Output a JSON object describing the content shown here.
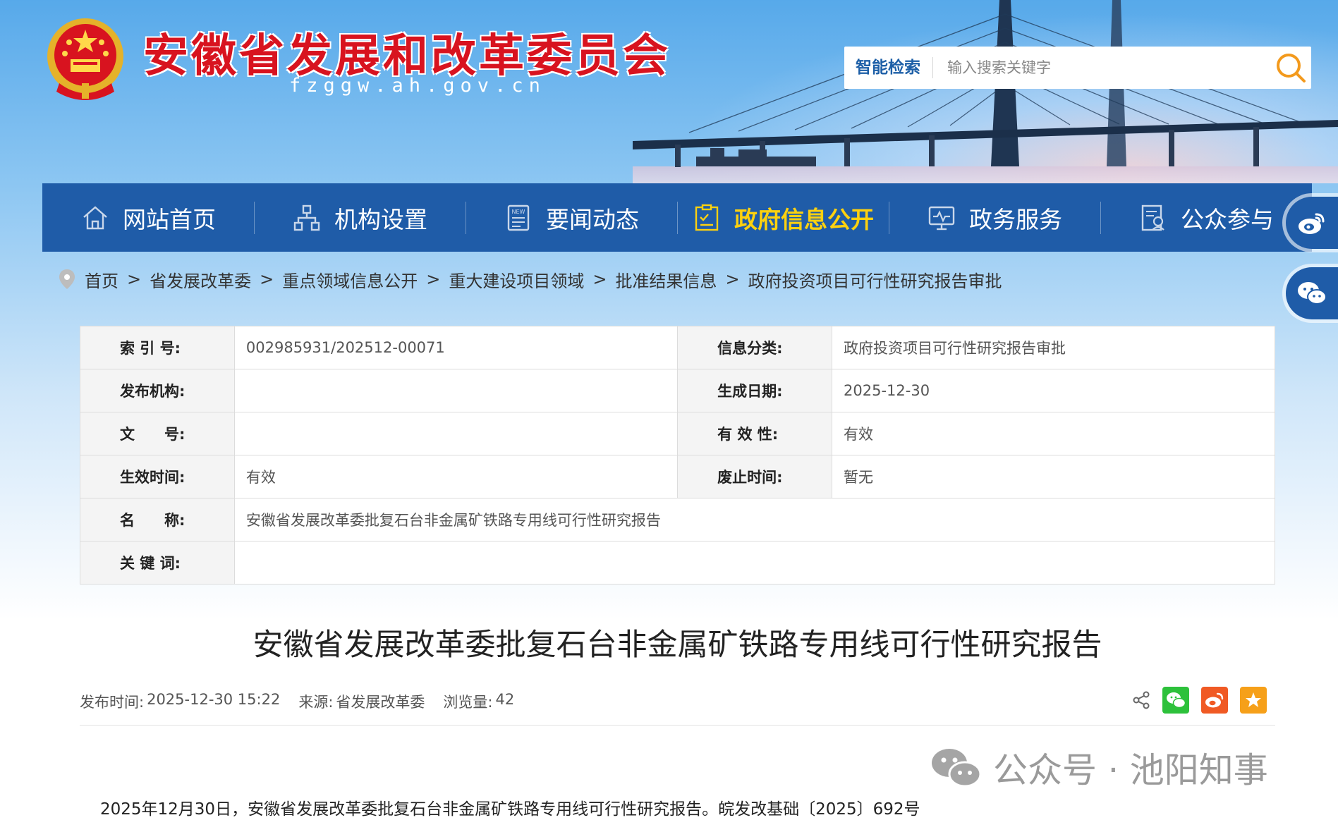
{
  "header": {
    "site_title": "安徽省发展和改革委员会",
    "site_domain": "fzggw.ah.gov.cn",
    "search": {
      "label": "智能检索",
      "placeholder": "输入搜索关键字"
    }
  },
  "nav": {
    "items": [
      {
        "label": "网站首页",
        "icon": "home-icon"
      },
      {
        "label": "机构设置",
        "icon": "org-chart-icon"
      },
      {
        "label": "要闻动态",
        "icon": "news-icon"
      },
      {
        "label": "政府信息公开",
        "icon": "info-disclosure-icon",
        "active": true
      },
      {
        "label": "政务服务",
        "icon": "monitor-icon"
      },
      {
        "label": "公众参与",
        "icon": "participation-icon"
      }
    ],
    "active_color": "#fdd10f",
    "bar_color": "#1f5ca8"
  },
  "floating": {
    "weibo": "weibo-icon",
    "wechat": "wechat-icon"
  },
  "breadcrumb": {
    "items": [
      "首页",
      "省发展改革委",
      "重点领域信息公开",
      "重大建设项目领域",
      "批准结果信息",
      "政府投资项目可行性研究报告审批"
    ],
    "separator": ">"
  },
  "info": {
    "index_no_label": "索 引 号:",
    "index_no": "002985931/202512-00071",
    "category_label": "信息分类:",
    "category": "政府投资项目可行性研究报告审批",
    "publisher_label": "发布机构:",
    "publisher": "",
    "created_label": "生成日期:",
    "created": "2025-12-30",
    "doc_no_label": "文　　号:",
    "doc_no": "",
    "validity_label": "有 效 性:",
    "validity": "有效",
    "effective_label": "生效时间:",
    "effective": "有效",
    "abolished_label": "废止时间:",
    "abolished": "暂无",
    "name_label": "名　　称:",
    "name": "安徽省发展改革委批复石台非金属矿铁路专用线可行性研究报告",
    "keywords_label": "关 键 词:",
    "keywords": ""
  },
  "article": {
    "title": "安徽省发展改革委批复石台非金属矿铁路专用线可行性研究报告",
    "meta": {
      "time_label": "发布时间:",
      "time": "2025-12-30 15:22",
      "source_label": "来源:",
      "source": "省发展改革委",
      "views_label": "浏览量:",
      "views": "42"
    },
    "share_icons": [
      "share-icon",
      "wechat-share-icon",
      "weibo-share-icon",
      "favorite-icon"
    ],
    "body": "2025年12月30日，安徽省发展改革委批复石台非金属矿铁路专用线可行性研究报告。皖发改基础〔2025〕692号"
  },
  "watermark": {
    "text": "公众号 · 池阳知事"
  }
}
